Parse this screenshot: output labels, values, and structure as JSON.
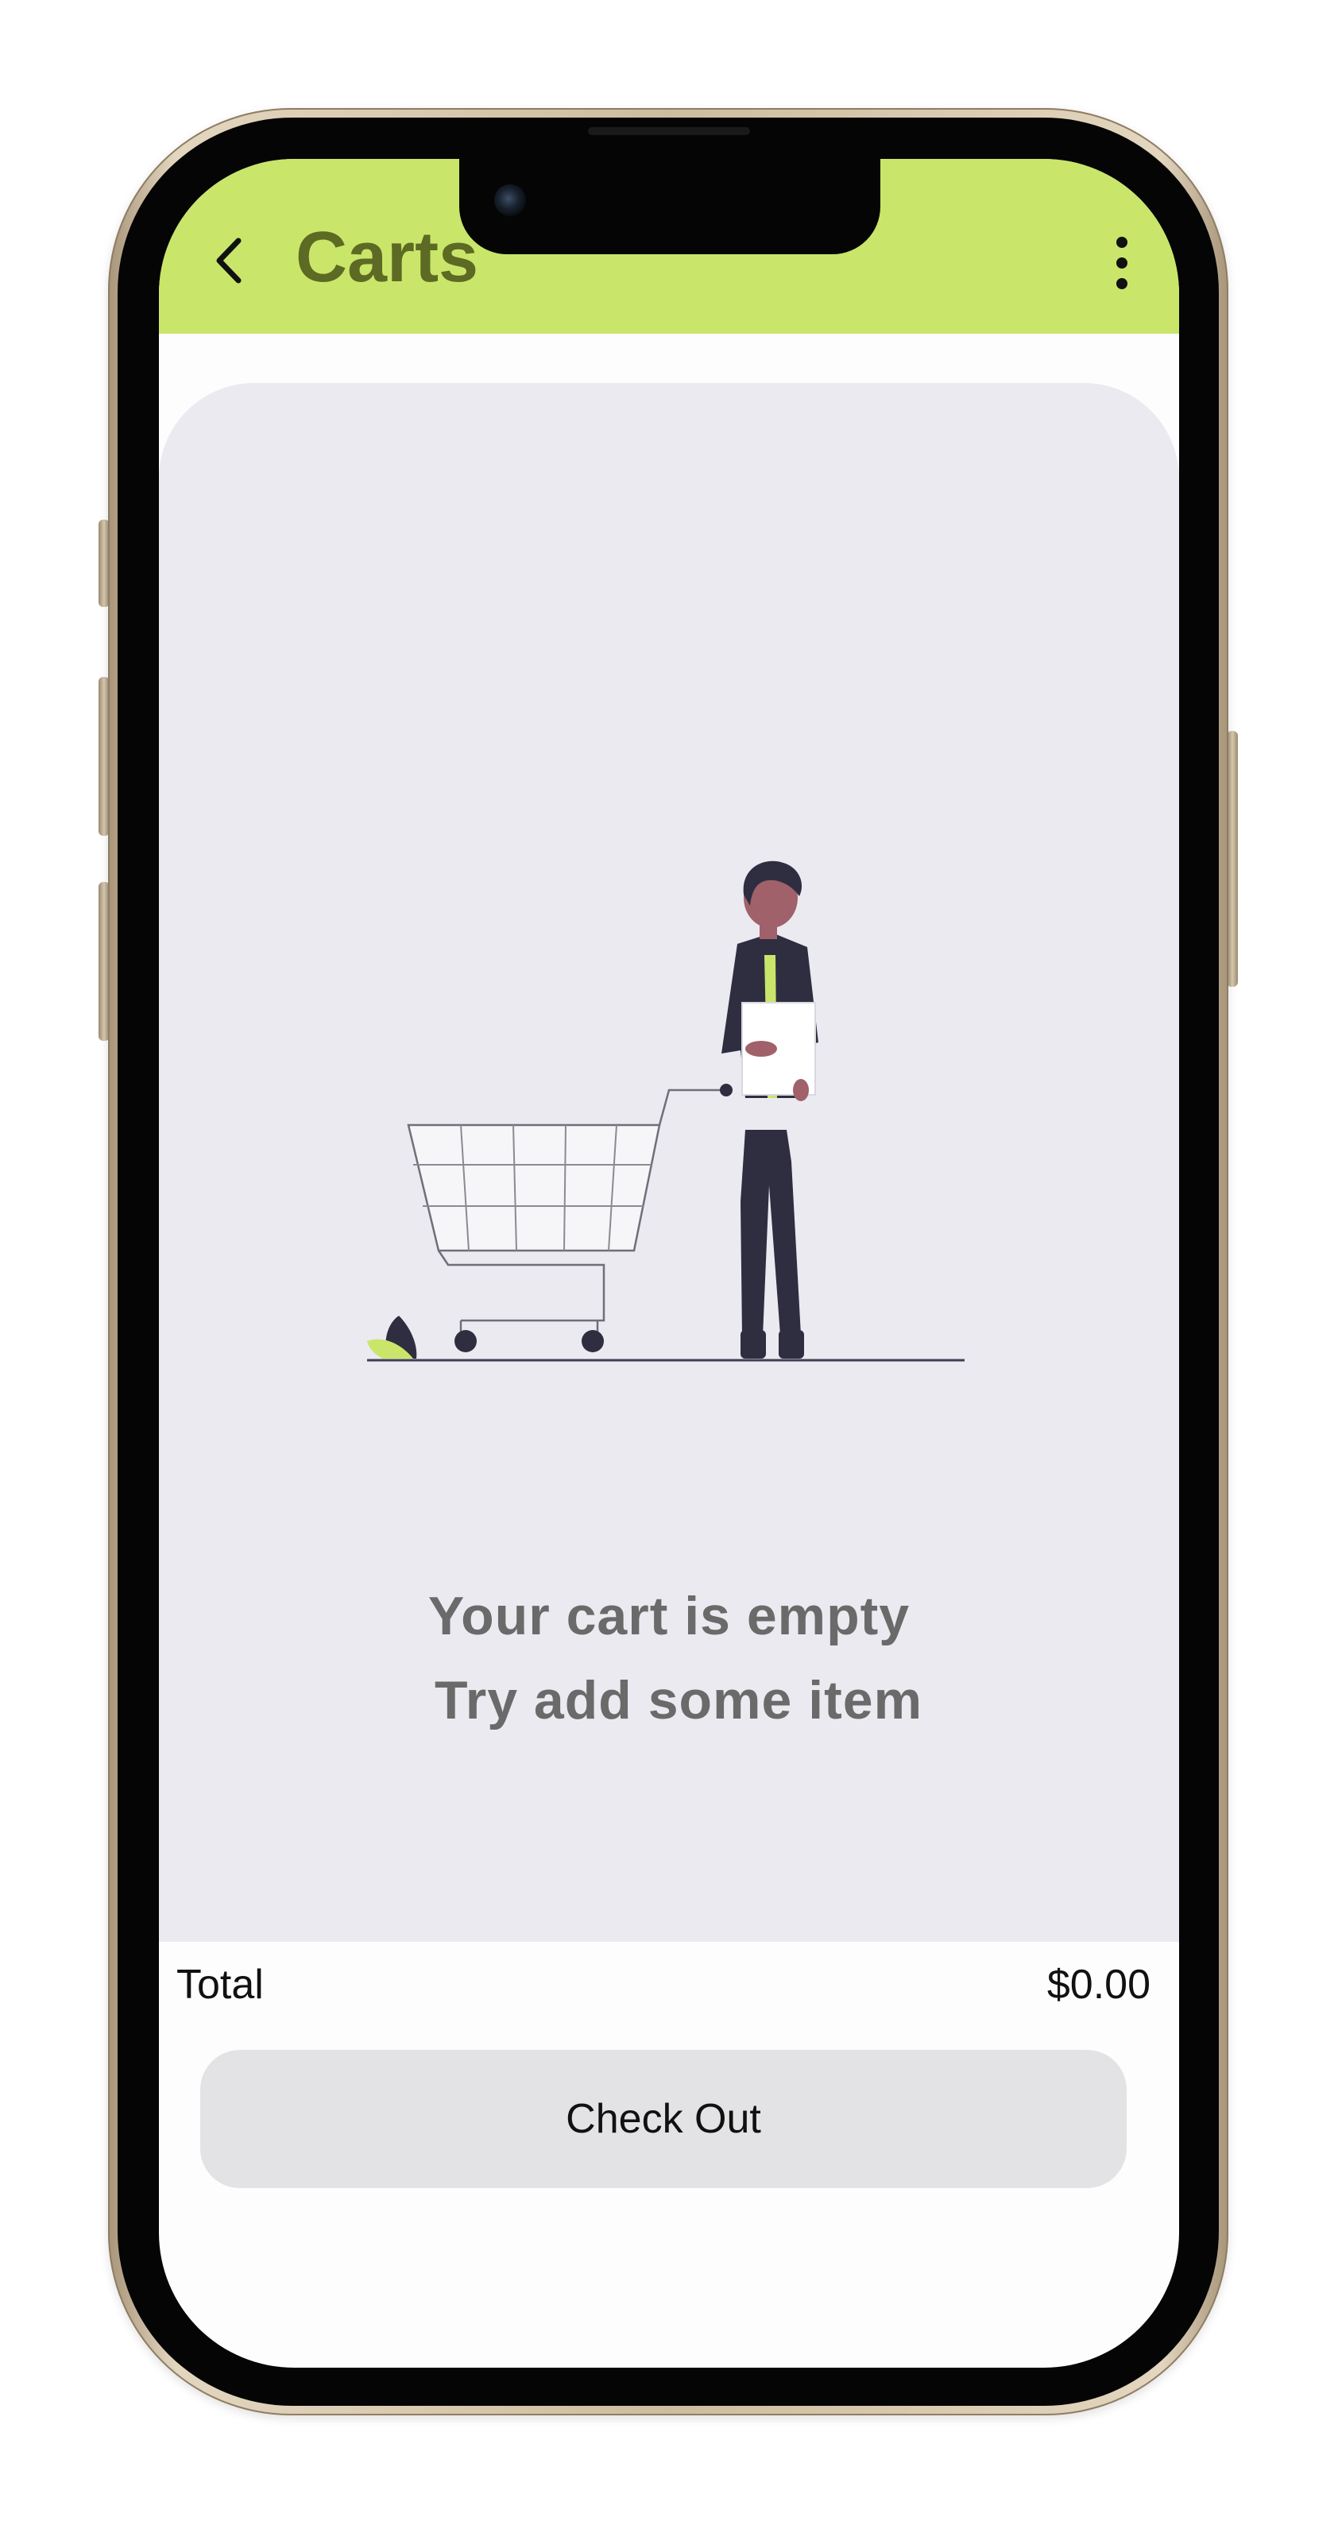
{
  "app_bar": {
    "title": "Carts",
    "back_icon": "chevron-left-icon",
    "menu_icon": "more-vertical-icon",
    "background": "#c9e66a",
    "title_color": "#5c6a24"
  },
  "empty_state": {
    "illustration": "shopping-cart-person-illustration",
    "line1": "Your cart is empty",
    "line2": "Try  add some item",
    "card_background": "#ebeaf0"
  },
  "summary": {
    "total_label": "Total",
    "total_value": "$0.00"
  },
  "checkout": {
    "label": "Check Out"
  },
  "colors": {
    "accent": "#c9e66a",
    "figure": "#2f2e41",
    "skin": "#a0616a"
  }
}
